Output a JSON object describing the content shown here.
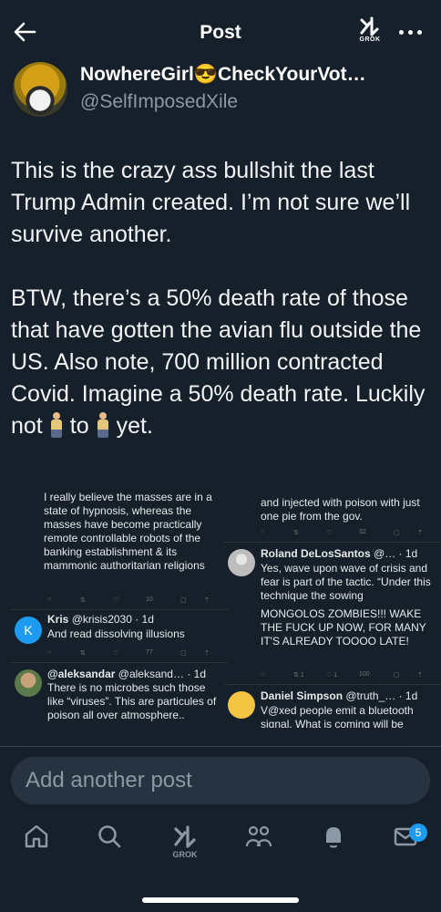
{
  "header": {
    "title": "Post",
    "grok_label": "GROK"
  },
  "author": {
    "display_name": "NowhereGirl😎CheckYourVot…",
    "handle": "@SelfImposedXile"
  },
  "tweet": {
    "paragraph1": "This is the crazy ass bullshit the last Trump Admin created. I’m not sure we’ll survive another.",
    "paragraph2_before": "BTW, there’s a 50% death rate of those that have gotten the avian flu outside the US. Also note, 700 million contracted Covid. Imagine a 50% death rate. Luckily not",
    "paragraph2_mid": "to",
    "paragraph2_after": "yet."
  },
  "screenshot": {
    "left": [
      {
        "text": "I really believe the masses are in a state of hypnosis, whereas the masses have become practically remote controllable robots of the banking establishment & its mammonic authoritarian religions",
        "views": "10"
      },
      {
        "name": "Kris",
        "handle": "@krisis2030 · 1d",
        "text": "And read dissolving illusions",
        "views": "77",
        "avatar_letter": "K"
      },
      {
        "name": "@aleksandar",
        "handle": "@aleksand… · 1d",
        "text": "There is no microbes such those like “viruses”. This  are particules of poison all over atmosphere.."
      }
    ],
    "right": [
      {
        "text": "and injected with poison with just one pie from the gov.",
        "views": "32"
      },
      {
        "name": "Roland DeLosSantos",
        "handle": "@… · 1d",
        "text": "Yes, wave upon wave of crisis and fear is part of the tactic. “Under this technique the sowing",
        "text2": "MONGOLOS ZOMBIES!!! WAKE THE FUCK UP NOW, FOR MANY IT'S ALREADY TOOOO LATE!",
        "replies": "1",
        "likes": "1",
        "views": "100"
      },
      {
        "name": "Daniel Simpson",
        "handle": "@truth_… · 1d",
        "text": "V@xed people emit a bluetooth signal. What is coming will be"
      }
    ]
  },
  "reply": {
    "placeholder": "Add another post"
  },
  "nav": {
    "grok_label": "GROK",
    "messages_badge": "5"
  },
  "colors": {
    "background": "#15202b",
    "accent": "#1d9bf0",
    "muted": "#8b98a5"
  },
  "icons": [
    "back-arrow-icon",
    "grok-icon",
    "more-icon",
    "home-icon",
    "search-icon",
    "grok-icon",
    "communities-icon",
    "notifications-icon",
    "messages-icon"
  ]
}
